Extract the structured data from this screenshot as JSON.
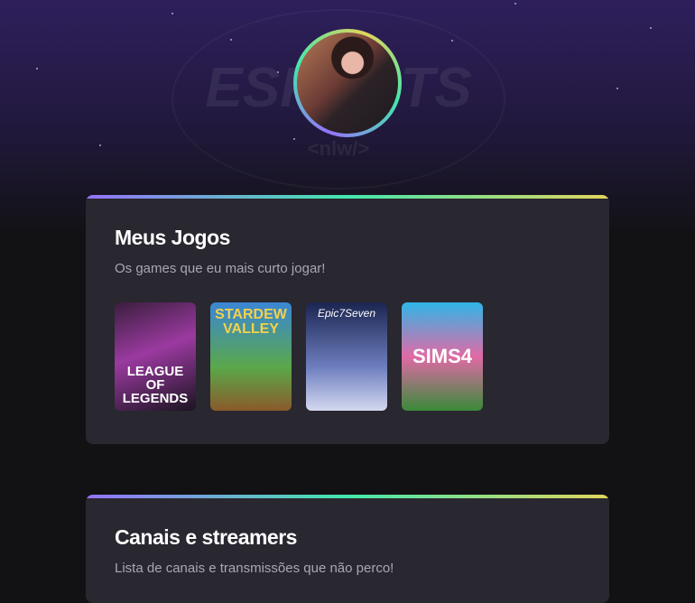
{
  "header": {
    "watermark_title": "ESPORTS",
    "watermark_sub": "<nlw/>"
  },
  "sections": [
    {
      "title": "Meus Jogos",
      "subtitle": "Os games que eu mais curto jogar!",
      "games": [
        {
          "name": "LEAGUE OF LEGENDS",
          "colors": [
            "#3a1e3e",
            "#9b3aa0",
            "#1a1420"
          ]
        },
        {
          "name": "STARDEW VALLEY",
          "colors": [
            "#3b86d6",
            "#5aa84a",
            "#8a5a2b"
          ]
        },
        {
          "name": "Epic7Seven",
          "colors": [
            "#1b2550",
            "#6e7fbf",
            "#d4d8f0"
          ]
        },
        {
          "name": "SIMS4",
          "colors": [
            "#2fb6e8",
            "#e06aa6",
            "#3a8a3a"
          ]
        }
      ]
    },
    {
      "title": "Canais e streamers",
      "subtitle": "Lista de canais e transmissões que não perco!"
    }
  ]
}
